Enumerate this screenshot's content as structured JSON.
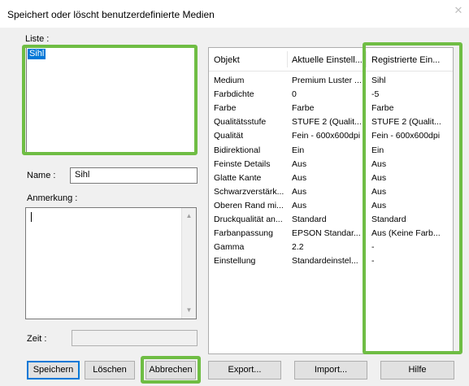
{
  "dialog": {
    "title": "Speichert oder löscht benutzerdefinierte Medien",
    "close_glyph": "✕"
  },
  "list": {
    "label": "Liste :",
    "items": [
      "Sihl"
    ]
  },
  "name_field": {
    "label": "Name :",
    "value": "Sihl"
  },
  "remark": {
    "label": "Anmerkung :",
    "value": ""
  },
  "time_field": {
    "label": "Zeit :",
    "value": ""
  },
  "table": {
    "headers": [
      "Objekt",
      "Aktuelle Einstell...",
      "Registrierte Ein..."
    ],
    "rows": [
      [
        "Medium",
        "Premium Luster ...",
        "Sihl"
      ],
      [
        "Farbdichte",
        "0",
        "-5"
      ],
      [
        "Farbe",
        "Farbe",
        "Farbe"
      ],
      [
        "Qualitätsstufe",
        "STUFE 2 (Qualit...",
        "STUFE 2 (Qualit..."
      ],
      [
        "Qualität",
        "Fein - 600x600dpi",
        "Fein - 600x600dpi"
      ],
      [
        "Bidirektional",
        "Ein",
        "Ein"
      ],
      [
        "Feinste Details",
        "Aus",
        "Aus"
      ],
      [
        "Glatte Kante",
        "Aus",
        "Aus"
      ],
      [
        "Schwarzverstärk...",
        "Aus",
        "Aus"
      ],
      [
        "Oberen Rand mi...",
        "Aus",
        "Aus"
      ],
      [
        "Druckqualität an...",
        "Standard",
        "Standard"
      ],
      [
        "Farbanpassung",
        "EPSON Standar...",
        "Aus (Keine Farb..."
      ],
      [
        "Gamma",
        "2.2",
        "-"
      ],
      [
        "Einstellung",
        "Standardeinstel...",
        "-"
      ]
    ]
  },
  "buttons": {
    "save": "Speichern",
    "delete": "Löschen",
    "cancel": "Abbrechen",
    "export": "Export...",
    "import": "Import...",
    "help": "Hilfe"
  },
  "colors": {
    "highlight": "#6fbd44",
    "selection": "#0078d7"
  }
}
